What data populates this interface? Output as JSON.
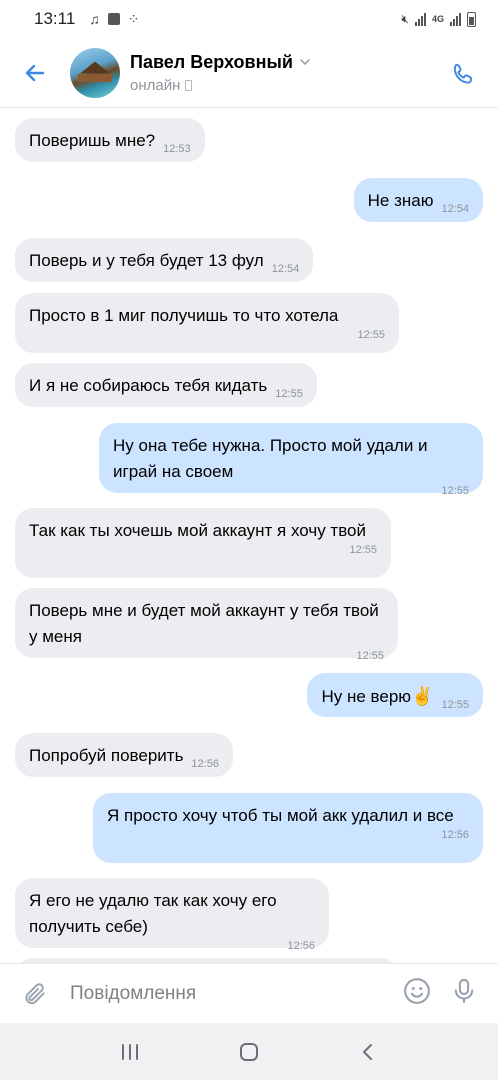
{
  "status_bar": {
    "time": "13:11",
    "network": "4G"
  },
  "header": {
    "name": "Павел Верховный",
    "status": "онлайн"
  },
  "messages": [
    {
      "dir": "in",
      "text": "Поверишь мне?",
      "time": "12:53"
    },
    {
      "dir": "out",
      "text": "Не знаю",
      "time": "12:54"
    },
    {
      "dir": "in",
      "text": "Поверь и у тебя будет 13 фул",
      "time": "12:54"
    },
    {
      "dir": "in",
      "text": "Просто в 1 миг получишь то что хотела",
      "time": "12:55"
    },
    {
      "dir": "in",
      "text": "И я не собираюсь тебя кидать",
      "time": "12:55"
    },
    {
      "dir": "out",
      "text": "Ну она тебе нужна. Просто мой удали и играй на своем",
      "time": "12:55"
    },
    {
      "dir": "in",
      "text": "Так как ты хочешь мой аккаунт я хочу твой",
      "time": "12:55"
    },
    {
      "dir": "in",
      "text": "Поверь мне и будет мой аккаунт у тебя твой у меня",
      "time": "12:55"
    },
    {
      "dir": "out",
      "text": "Ну не верю",
      "emoji": "✌️",
      "time": "12:55"
    },
    {
      "dir": "in",
      "text": "Попробуй поверить",
      "time": "12:56"
    },
    {
      "dir": "out",
      "text": "Я просто хочу чтоб ты мой акк удалил и все",
      "time": "12:56"
    },
    {
      "dir": "in",
      "text": "Я его не удалю так как хочу его получить себе)",
      "time": "12:56"
    }
  ],
  "composer": {
    "placeholder": "Повідомлення"
  },
  "colors": {
    "accent": "#4a76a8",
    "bubble_in": "#ebedf0",
    "bubble_out": "#cce4ff",
    "icon_blue": "#3f8ae0"
  }
}
